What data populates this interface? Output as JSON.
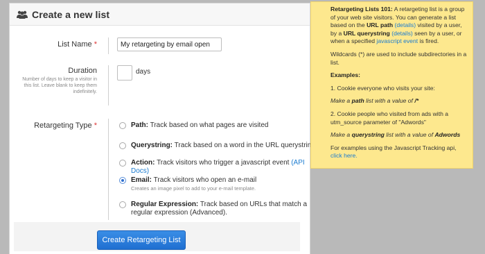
{
  "header": {
    "title": "Create a new list",
    "icon": "users-icon"
  },
  "list_name": {
    "label": "List Name",
    "required": "*",
    "value": "My retargeting by email open"
  },
  "duration": {
    "label": "Duration",
    "help": "Number of days to keep a visitor in this list. Leave blank to keep them indefinitely.",
    "value": "",
    "unit": "days"
  },
  "retargeting_type": {
    "label": "Retargeting Type",
    "required": "*",
    "options": [
      {
        "title": "Path:",
        "desc": "Track based on what pages are visited",
        "link": "",
        "sub": "",
        "checked": false
      },
      {
        "title": "Querystring:",
        "desc": "Track based on a word in the URL querystring",
        "link": "",
        "sub": "",
        "checked": false
      },
      {
        "title": "Action:",
        "desc": "Track visitors who trigger a javascript event",
        "link": "(API Docs)",
        "sub": "",
        "checked": false
      },
      {
        "title": "Email:",
        "desc": "Track visitors who open an e-mail",
        "link": "",
        "sub": "Creates an image pixel to add to your e-mail template.",
        "checked": true
      },
      {
        "title": "Regular Expression:",
        "desc": "Track based on URLs that match a regular expression (Advanced).",
        "link": "",
        "sub": "",
        "checked": false
      }
    ]
  },
  "submit_label": "Create Retargeting List",
  "note": {
    "p1_title": "Retargeting Lists 101:",
    "p1_a": "A retargeting list is a group of your web site visitors. You can generate a list based on the",
    "p1_urlpath": "URL path",
    "p1_details1": "(details)",
    "p1_b": "visited by a user, by a",
    "p1_urlquery": "URL querystring",
    "p1_details2": "(details)",
    "p1_c": "seen by a user, or when a specified",
    "p1_jsevent": "javascript event",
    "p1_d": "is fired.",
    "p2": "Wildcards (*) are used to include subdirectories in a list.",
    "examples": "Examples:",
    "ex1": "1. Cookie everyone who visits your site:",
    "ex1_italic_a": "Make a",
    "ex1_bold": "path",
    "ex1_italic_b": "list with a value of",
    "ex1_value": "/*",
    "ex2": "2. Cookie people who visited from ads with a utm_source parameter of \"Adwords\"",
    "ex2_italic_a": "Make a",
    "ex2_bold": "querystring",
    "ex2_italic_b": "list with a value of",
    "ex2_value": "Adwords",
    "js_a": "For examples using the Javascript Tracking api,",
    "js_link": "click here."
  },
  "colors": {
    "accent": "#1a7bd0",
    "button": "#2e7fdc",
    "note_bg": "#fde88e",
    "required": "#d33333"
  }
}
